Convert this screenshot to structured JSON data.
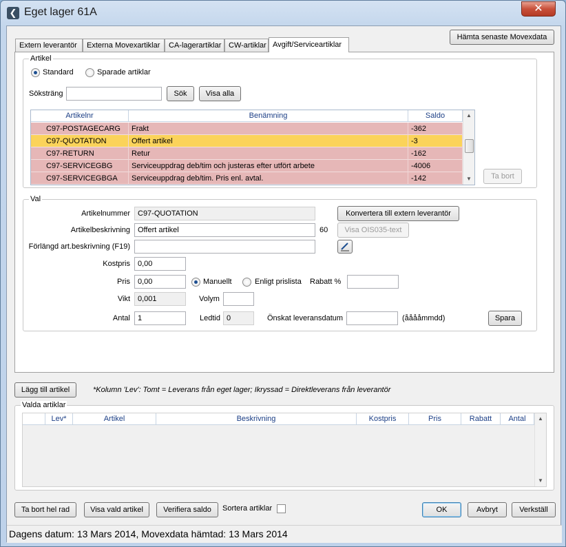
{
  "window": {
    "title": "Eget lager 61A",
    "close_glyph": "✕",
    "icon": "back-arrow-icon"
  },
  "tabs": [
    {
      "label": "Extern leverantör",
      "active": false
    },
    {
      "label": "Externa Movexartiklar",
      "active": false
    },
    {
      "label": "CA-lagerartiklar",
      "active": false
    },
    {
      "label": "CW-artiklar",
      "active": false
    },
    {
      "label": "Avgift/Serviceartiklar",
      "active": true
    }
  ],
  "fetch_button": "Hämta senaste Movexdata",
  "artikel": {
    "legend": "Artikel",
    "radio_standard": "Standard",
    "radio_saved": "Sparade artiklar",
    "search_label": "Söksträng",
    "search_value": "",
    "search_button": "Sök",
    "show_all_button": "Visa alla",
    "remove_button": "Ta bort",
    "columns": [
      "Artikelnr",
      "Benämning",
      "Saldo"
    ],
    "rows": [
      {
        "artikelnr": "C97-POSTAGECARG",
        "benamning": "Frakt",
        "saldo": "-362",
        "selected": false
      },
      {
        "artikelnr": "C97-QUOTATION",
        "benamning": "Offert artikel",
        "saldo": "-3",
        "selected": true
      },
      {
        "artikelnr": "C97-RETURN",
        "benamning": "Retur",
        "saldo": "-162",
        "selected": false
      },
      {
        "artikelnr": "C97-SERVICEGBG",
        "benamning": "Serviceuppdrag deb/tim och justeras efter utfört arbete",
        "saldo": "-4006",
        "selected": false
      },
      {
        "artikelnr": "C97-SERVICEGBGA",
        "benamning": "Serviceuppdrag deb/tim. Pris enl. avtal.",
        "saldo": "-142",
        "selected": false
      }
    ],
    "colors": {
      "row": "#e6b7b7",
      "selected": "#fbd35a"
    }
  },
  "val": {
    "legend": "Val",
    "artikelnummer_label": "Artikelnummer",
    "artikelnummer_value": "C97-QUOTATION",
    "beskrivning_label": "Artikelbeskrivning",
    "beskrivning_value": "Offert artikel",
    "beskrivning_count": "60",
    "forlangd_label": "Förlängd art.beskrivning (F19)",
    "forlangd_value": "",
    "convert_button": "Konvertera till extern leverantör",
    "ois_button": "Visa OIS035-text",
    "kostpris_label": "Kostpris",
    "kostpris_value": "0,00",
    "pris_label": "Pris",
    "pris_value": "0,00",
    "manuellt_label": "Manuellt",
    "prislista_label": "Enligt prislista",
    "rabatt_label": "Rabatt %",
    "rabatt_value": "",
    "vikt_label": "Vikt",
    "vikt_value": "0,001",
    "volym_label": "Volym",
    "volym_value": "",
    "antal_label": "Antal",
    "antal_value": "1",
    "ledtid_label": "Ledtid",
    "ledtid_value": "0",
    "leveransdatum_label": "Önskat leveransdatum",
    "leveransdatum_value": "",
    "date_format": "(ååååmmdd)",
    "save_button": "Spara"
  },
  "add_button": "Lägg till artikel",
  "note": "*Kolumn 'Lev': Tomt = Leverans från eget lager; Ikryssad = Direktleverans från leverantör",
  "valda": {
    "legend": "Valda artiklar",
    "columns": [
      "",
      "Lev*",
      "Artikel",
      "Beskrivning",
      "Kostpris",
      "Pris",
      "Rabatt",
      "Antal"
    ]
  },
  "bottom": {
    "remove_row": "Ta bort hel rad",
    "show_selected": "Visa vald artikel",
    "verify_balance": "Verifiera saldo",
    "sort_label": "Sortera artiklar",
    "ok": "OK",
    "cancel": "Avbryt",
    "apply": "Verkställ"
  },
  "status": "Dagens datum: 13 Mars 2014, Movexdata hämtad: 13 Mars 2014"
}
